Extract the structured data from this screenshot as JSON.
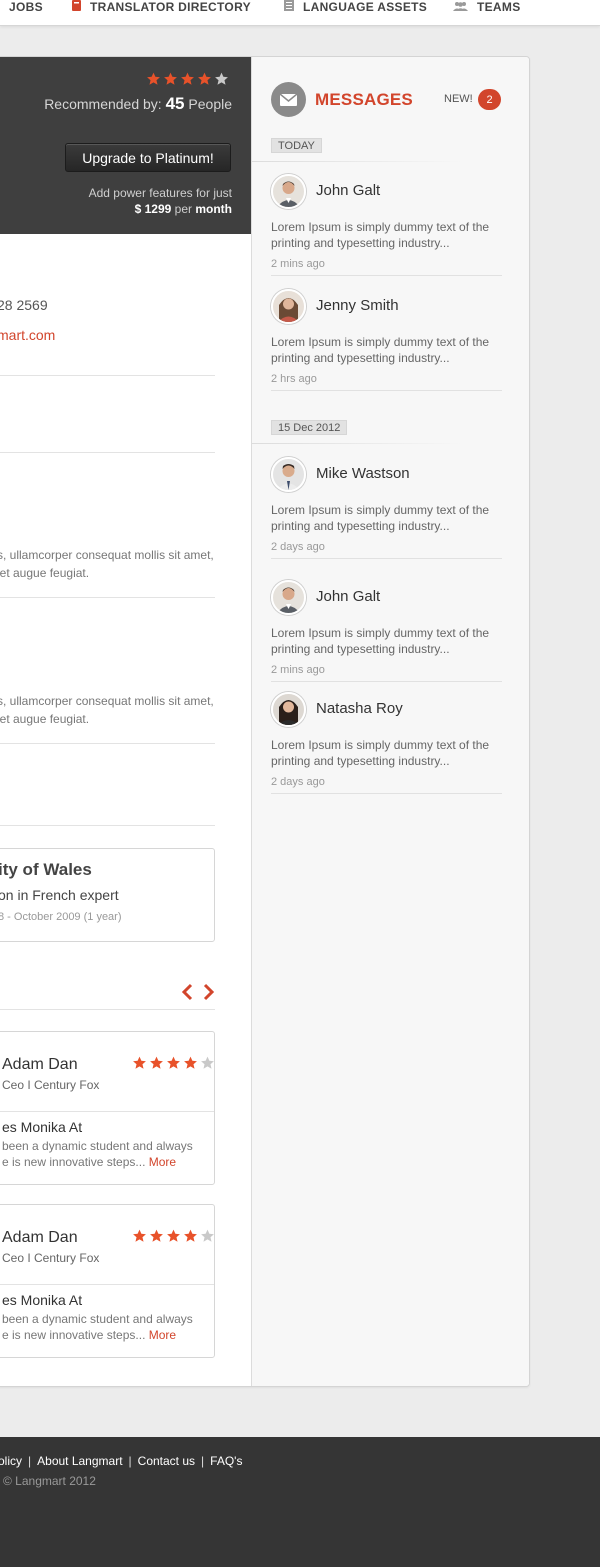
{
  "nav": {
    "items": [
      {
        "label": "JOBS",
        "icon": "briefcase-icon"
      },
      {
        "label": "TRANSLATOR DIRECTORY",
        "icon": "notebook-icon"
      },
      {
        "label": "LANGUAGE ASSETS",
        "icon": "document-icon"
      },
      {
        "label": "TEAMS",
        "icon": "team-icon"
      }
    ]
  },
  "promo": {
    "rating": 4,
    "rating_max": 5,
    "recommended_prefix": "Recommended by:",
    "recommended_count": "45",
    "recommended_suffix": "People",
    "upgrade_label": "Upgrade to Platinum!",
    "power_text": "Add power features for just",
    "price": "$ 1299",
    "per": "per",
    "period": "month"
  },
  "profile": {
    "phone": "28 2569",
    "email": "mart.com"
  },
  "sections": {
    "para1_line1": "s, ullamcorper consequat mollis sit amet,",
    "para1_line2": "iet augue feugiat.",
    "para2_line1": "s, ullamcorper consequat mollis sit amet,",
    "para2_line2": "iet augue feugiat."
  },
  "education": {
    "title": "ity of Wales",
    "subtitle": "on in French expert",
    "dates": "8 - October 2009 (1 year)"
  },
  "reviews": [
    {
      "name": "Adam Dan",
      "role": "Ceo I Century Fox",
      "rating": 4,
      "student": "es Monika At",
      "line1": "been a dynamic student and always",
      "line2": "e is new innovative steps...",
      "more": "More"
    },
    {
      "name": "Adam Dan",
      "role": "Ceo I Century Fox",
      "rating": 4,
      "student": "es Monika At",
      "line1": "been a dynamic student and always",
      "line2": "e is new innovative steps...",
      "more": "More"
    }
  ],
  "messages": {
    "title": "MESSAGES",
    "new_label": "NEW!",
    "new_count": "2",
    "groups": [
      {
        "date": "TODAY",
        "items": [
          {
            "name": "John Galt",
            "text_line1": "Lorem Ipsum is simply dummy text of the",
            "text_line2": "printing and typesetting industry...",
            "time": "2 mins ago"
          },
          {
            "name": "Jenny Smith",
            "text_line1": "Lorem Ipsum is simply dummy text of the",
            "text_line2": "printing and typesetting industry...",
            "time": "2 hrs ago"
          }
        ]
      },
      {
        "date": "15 Dec 2012",
        "items": [
          {
            "name": "Mike Wastson",
            "text_line1": "Lorem Ipsum is simply dummy text of the",
            "text_line2": "printing and typesetting industry...",
            "time": "2 days ago"
          },
          {
            "name": "John Galt",
            "text_line1": "Lorem Ipsum is simply dummy text of the",
            "text_line2": "printing and typesetting industry...",
            "time": "2 mins ago"
          },
          {
            "name": "Natasha Roy",
            "text_line1": "Lorem Ipsum is simply dummy text of the",
            "text_line2": "printing and typesetting industry...",
            "time": "2 days ago"
          }
        ]
      }
    ]
  },
  "footer": {
    "links": [
      "olicy",
      "About Langmart",
      "Contact us",
      "FAQ's"
    ],
    "copyright": "© Langmart 2012"
  },
  "colors": {
    "accent": "#d2452c",
    "promo_bg": "#3f3f3f",
    "footer_bg": "#353535"
  }
}
